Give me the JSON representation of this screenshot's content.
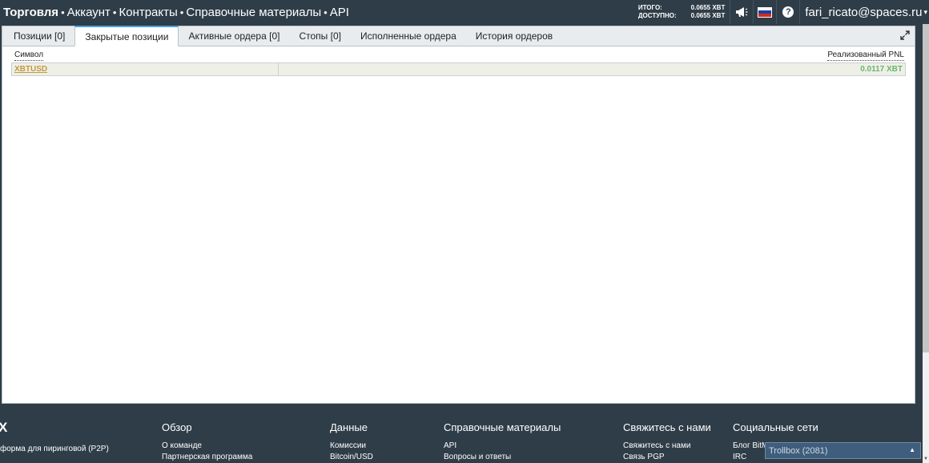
{
  "nav": {
    "items": [
      {
        "label": "Торговля"
      },
      {
        "label": "Аккаунт"
      },
      {
        "label": "Контракты"
      },
      {
        "label": "Справочные материалы"
      },
      {
        "label": "API"
      }
    ],
    "separator": "•"
  },
  "balances": {
    "total_label": "ИТОГО:",
    "total_value": "0.0655 XBT",
    "available_label": "ДОСТУПНО:",
    "available_value": "0.0655 XBT"
  },
  "user": {
    "email": "fari_ricato@spaces.ru",
    "caret": "▾",
    "help": "?"
  },
  "tabs": [
    {
      "label": "Позиции [0]"
    },
    {
      "label": "Закрытые позиции"
    },
    {
      "label": "Активные ордера [0]"
    },
    {
      "label": "Стопы [0]"
    },
    {
      "label": "Исполненные ордера"
    },
    {
      "label": "История ордеров"
    }
  ],
  "active_tab": "Закрытые позиции",
  "table": {
    "headers": {
      "symbol": "Символ",
      "pnl": "Реализованный PNL"
    },
    "rows": [
      {
        "symbol": "XBTUSD",
        "pnl": "0.0117 XBT"
      }
    ]
  },
  "footer": {
    "brand_fragment": "X",
    "brand_text": "форма для пиринговой (P2P)",
    "columns": [
      {
        "title": "Обзор",
        "links": [
          "О команде",
          "Партнерская программа"
        ]
      },
      {
        "title": "Данные",
        "links": [
          "Комиссии",
          "Bitcoin/USD"
        ]
      },
      {
        "title": "Справочные материалы",
        "links": [
          "API",
          "Вопросы и ответы"
        ]
      },
      {
        "title": "Свяжитесь с нами",
        "links": [
          "Свяжитесь с нами",
          "Связь PGP"
        ]
      },
      {
        "title": "Социальные сети",
        "links": [
          "Блог BitMEX",
          "IRC"
        ]
      }
    ]
  },
  "trollbox": {
    "label": "Trollbox (2081)",
    "arrow": "▲"
  },
  "colors": {
    "topbar": "#2f3d48",
    "pnl_positive": "#6ab86a",
    "symbol_link": "#c59a3c",
    "tab_accent": "#4aa3df"
  }
}
